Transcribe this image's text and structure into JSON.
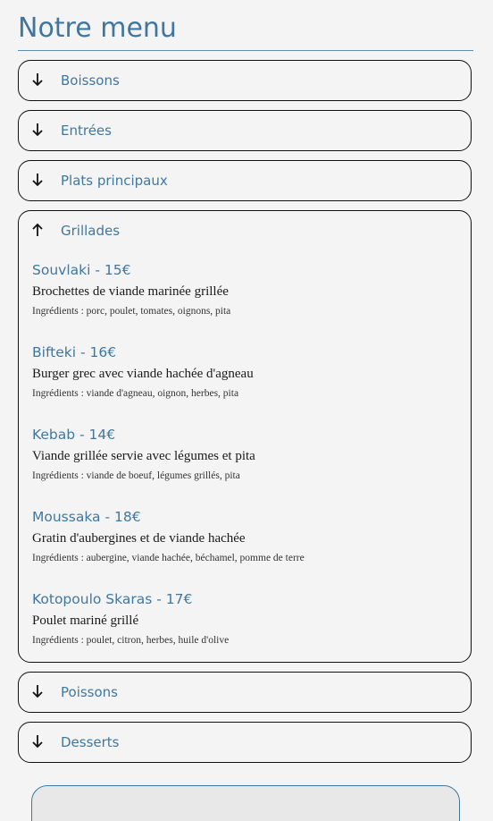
{
  "page": {
    "title": "Notre menu"
  },
  "sections": [
    {
      "label": "Boissons",
      "state": "collapsed",
      "icon": "arrow-down-icon"
    },
    {
      "label": "Entrées",
      "state": "collapsed",
      "icon": "arrow-down-icon"
    },
    {
      "label": "Plats principaux",
      "state": "collapsed",
      "icon": "arrow-down-icon"
    },
    {
      "label": "Grillades",
      "state": "expanded",
      "icon": "arrow-up-icon",
      "dishes": [
        {
          "name": "Souvlaki - 15€",
          "description": "Brochettes de viande marinée grillée",
          "ingredients": "Ingrédients : porc, poulet, tomates, oignons, pita"
        },
        {
          "name": "Bifteki - 16€",
          "description": "Burger grec avec viande hachée d'agneau",
          "ingredients": "Ingrédients : viande d'agneau, oignon, herbes, pita"
        },
        {
          "name": "Kebab - 14€",
          "description": "Viande grillée servie avec légumes et pita",
          "ingredients": "Ingrédients : viande de boeuf, légumes grillés, pita"
        },
        {
          "name": "Moussaka - 18€",
          "description": "Gratin d'aubergines et de viande hachée",
          "ingredients": "Ingrédients : aubergine, viande hachée, béchamel, pomme de terre"
        },
        {
          "name": "Kotopoulo Skaras - 17€",
          "description": "Poulet mariné grillé",
          "ingredients": "Ingrédients : poulet, citron, herbes, huile d'olive"
        }
      ]
    },
    {
      "label": "Poissons",
      "state": "collapsed",
      "icon": "arrow-down-icon"
    },
    {
      "label": "Desserts",
      "state": "collapsed",
      "icon": "arrow-down-icon"
    }
  ],
  "colors": {
    "accent": "#41779f",
    "background": "#f4f4f4",
    "border": "#111111",
    "card": "#e8e8e8"
  }
}
